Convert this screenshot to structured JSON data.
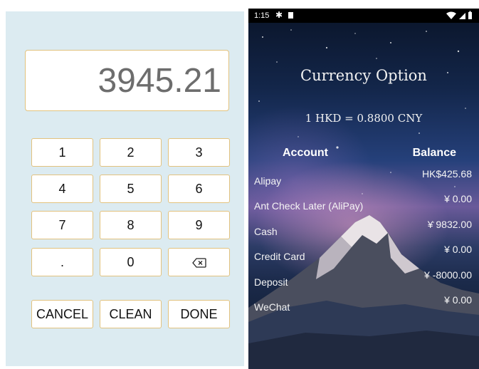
{
  "calculator": {
    "display_value": "3945.21",
    "keys": {
      "k1": "1",
      "k2": "2",
      "k3": "3",
      "k4": "4",
      "k5": "5",
      "k6": "6",
      "k7": "7",
      "k8": "8",
      "k9": "9",
      "dot": ".",
      "k0": "0"
    },
    "backspace_icon": "backspace-icon",
    "actions": {
      "cancel": "CANCEL",
      "clean": "CLEAN",
      "done": "DONE"
    }
  },
  "status_bar": {
    "time": "1:15",
    "icons": [
      "gear-icon",
      "sd-card-icon",
      "wifi-icon",
      "signal-icon",
      "battery-icon"
    ]
  },
  "currency": {
    "title": "Currency Option",
    "rate": "1 HKD = 0.8800 CNY",
    "headers": {
      "account": "Account",
      "balance": "Balance"
    },
    "accounts": [
      {
        "name": "Alipay",
        "balance": "HK$425.68"
      },
      {
        "name": "Ant Check Later (AliPay)",
        "balance": "¥ 0.00"
      },
      {
        "name": "Cash",
        "balance": "¥ 9832.00"
      },
      {
        "name": "Credit Card",
        "balance": "¥ 0.00"
      },
      {
        "name": "Deposit",
        "balance": "¥ -8000.00"
      },
      {
        "name": "WeChat",
        "balance": "¥ 0.00"
      }
    ]
  },
  "colors": {
    "keypad_background": "#dcebf1",
    "key_border": "#e2c27e",
    "display_text": "#6d6d6d"
  }
}
